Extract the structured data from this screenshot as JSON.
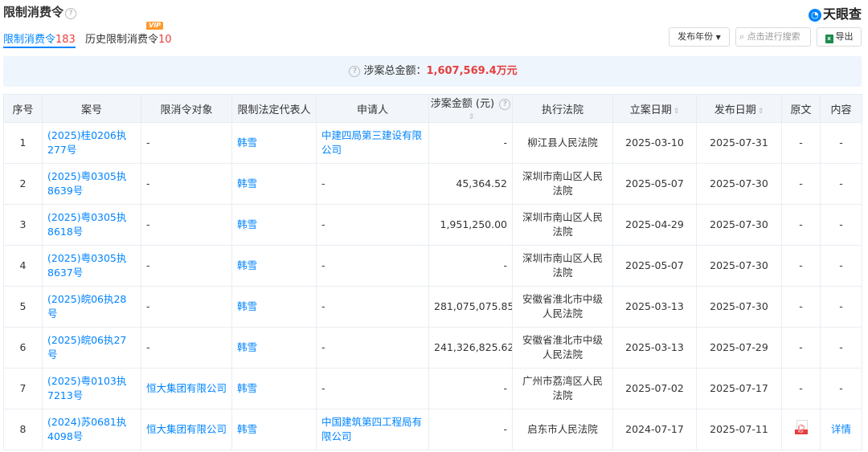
{
  "header": {
    "title": "限制消费令",
    "help_icon": "question-icon",
    "logo_text": "天眼查"
  },
  "tabs": [
    {
      "label": "限制消费令",
      "count": "183",
      "active": true
    },
    {
      "label": "历史限制消费令",
      "count": "10",
      "badge": "VIP"
    }
  ],
  "toolbar": {
    "year_filter_label": "发布年份",
    "search_placeholder": "点击进行搜索",
    "export_label": "导出"
  },
  "summary": {
    "label": "涉案总金额：",
    "amount": "1,607,569.4万元"
  },
  "table": {
    "columns": [
      "序号",
      "案号",
      "限消令对象",
      "限制法定代表人",
      "申请人",
      "涉案金额 (元)",
      "执行法院",
      "立案日期",
      "发布日期",
      "原文",
      "内容"
    ],
    "rows": [
      {
        "no": "1",
        "case": "(2025)桂0206执277号",
        "target": "-",
        "rep": "韩雪",
        "applicant": "中建四局第三建设有限公司",
        "amount": "-",
        "court": "柳江县人民法院",
        "filed": "2025-03-10",
        "published": "2025-07-31",
        "original": "-",
        "content": "-"
      },
      {
        "no": "2",
        "case": "(2025)粤0305执8639号",
        "target": "-",
        "rep": "韩雪",
        "applicant": "-",
        "amount": "45,364.52",
        "court": "深圳市南山区人民法院",
        "filed": "2025-05-07",
        "published": "2025-07-30",
        "original": "-",
        "content": "-"
      },
      {
        "no": "3",
        "case": "(2025)粤0305执8618号",
        "target": "-",
        "rep": "韩雪",
        "applicant": "-",
        "amount": "1,951,250.00",
        "court": "深圳市南山区人民法院",
        "filed": "2025-04-29",
        "published": "2025-07-30",
        "original": "-",
        "content": "-"
      },
      {
        "no": "4",
        "case": "(2025)粤0305执8637号",
        "target": "-",
        "rep": "韩雪",
        "applicant": "-",
        "amount": "-",
        "court": "深圳市南山区人民法院",
        "filed": "2025-05-07",
        "published": "2025-07-30",
        "original": "-",
        "content": "-"
      },
      {
        "no": "5",
        "case": "(2025)皖06执28号",
        "target": "-",
        "rep": "韩雪",
        "applicant": "-",
        "amount": "281,075,075.85",
        "court": "安徽省淮北市中级人民法院",
        "filed": "2025-03-13",
        "published": "2025-07-30",
        "original": "-",
        "content": "-"
      },
      {
        "no": "6",
        "case": "(2025)皖06执27号",
        "target": "-",
        "rep": "韩雪",
        "applicant": "-",
        "amount": "241,326,825.62",
        "court": "安徽省淮北市中级人民法院",
        "filed": "2025-03-13",
        "published": "2025-07-29",
        "original": "-",
        "content": "-"
      },
      {
        "no": "7",
        "case": "(2025)粤0103执7213号",
        "target": "恒大集团有限公司",
        "rep": "韩雪",
        "applicant": "-",
        "amount": "-",
        "court": "广州市荔湾区人民法院",
        "filed": "2025-07-02",
        "published": "2025-07-17",
        "original": "-",
        "content": "-"
      },
      {
        "no": "8",
        "case": "(2024)苏0681执4098号",
        "target": "恒大集团有限公司",
        "rep": "韩雪",
        "applicant": "中国建筑第四工程局有限公司",
        "amount": "-",
        "court": "启东市人民法院",
        "filed": "2024-07-17",
        "published": "2025-07-11",
        "original": "PDF",
        "content": "详情"
      }
    ]
  },
  "colors": {
    "accent": "#0084ff",
    "highlight": "#e53e3e"
  }
}
